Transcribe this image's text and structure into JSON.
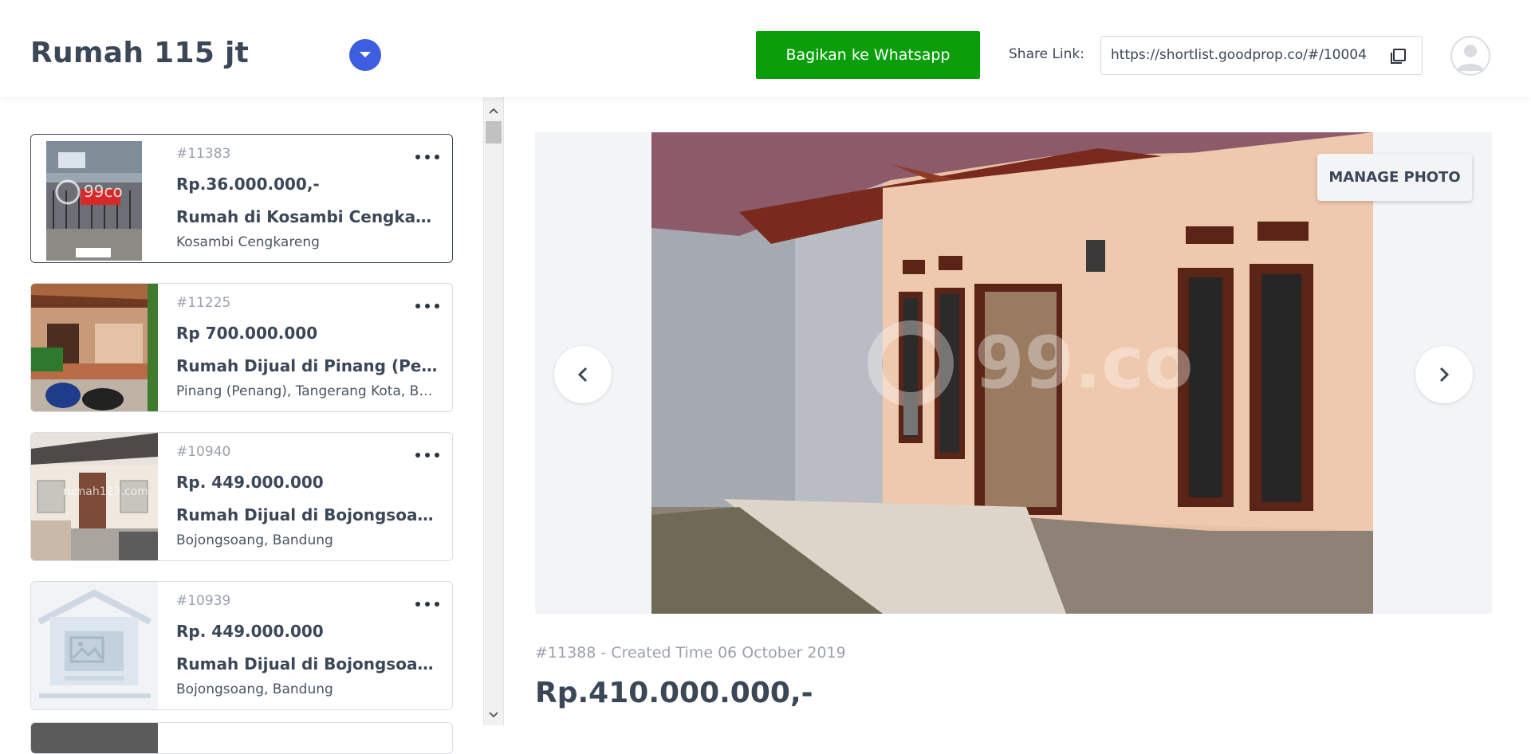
{
  "header": {
    "title": "Rumah 115 jt",
    "whatsapp_label": "Bagikan ke Whatsapp",
    "share_label": "Share Link:",
    "share_url": "https://shortlist.goodprop.co/#/10004",
    "accent_color": "#3d5ee1",
    "whatsapp_color": "#0a9f0a"
  },
  "listings": [
    {
      "id": "#11383",
      "price": "Rp.36.000.000,-",
      "name": "Rumah di Kosambi Cengkareng",
      "location": "Kosambi Cengkareng",
      "selected": true
    },
    {
      "id": "#11225",
      "price": "Rp 700.000.000",
      "name": "Rumah Dijual di Pinang (Penang)",
      "location": "Pinang (Penang), Tangerang Kota, Banten"
    },
    {
      "id": "#10940",
      "price": "Rp. 449.000.000",
      "name": "Rumah Dijual di Bojongsoang, Bandung",
      "location": "Bojongsoang, Bandung"
    },
    {
      "id": "#10939",
      "price": "Rp. 449.000.000",
      "name": "Rumah Dijual di Bojongsoang, Bandung",
      "location": "Bojongsoang, Bandung"
    }
  ],
  "detail": {
    "manage_photo_label": "MANAGE PHOTO",
    "meta": "#11388 - Created Time 06 October 2019",
    "price": "Rp.410.000.000,-"
  },
  "icons": {
    "title_dropdown": "chevron-down-icon",
    "copy": "copy-icon",
    "avatar": "user-avatar-icon",
    "more": "more-horizontal-icon",
    "prev": "chevron-left-icon",
    "next": "chevron-right-icon"
  }
}
